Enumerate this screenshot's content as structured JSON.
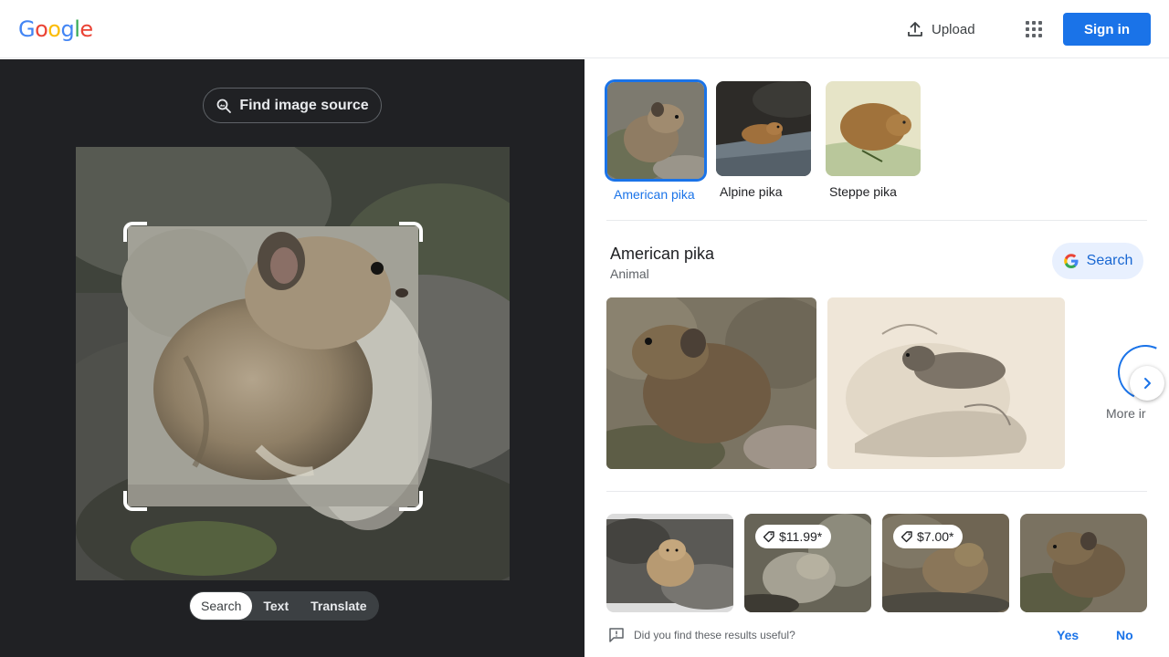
{
  "header": {
    "logo_letters": [
      {
        "ch": "G",
        "color": "#4285F4"
      },
      {
        "ch": "o",
        "color": "#EA4335"
      },
      {
        "ch": "o",
        "color": "#FBBC05"
      },
      {
        "ch": "g",
        "color": "#4285F4"
      },
      {
        "ch": "l",
        "color": "#34A853"
      },
      {
        "ch": "e",
        "color": "#EA4335"
      }
    ],
    "upload_label": "Upload",
    "apps_icon": "apps-grid-icon",
    "signin_label": "Sign in"
  },
  "left_panel": {
    "find_source_label": "Find image source",
    "modes": [
      {
        "label": "Search",
        "active": true
      },
      {
        "label": "Text",
        "active": false
      },
      {
        "label": "Translate",
        "active": false
      }
    ]
  },
  "right_panel": {
    "related": [
      {
        "label": "American pika",
        "selected": true
      },
      {
        "label": "Alpine pika",
        "selected": false
      },
      {
        "label": "Steppe pika",
        "selected": false
      }
    ],
    "entity": {
      "title": "American pika",
      "subtitle": "Animal",
      "search_label": "Search"
    },
    "more_label": "More ir",
    "results": [
      {
        "price": ""
      },
      {
        "price": "$11.99*"
      },
      {
        "price": "$7.00*"
      },
      {
        "price": ""
      }
    ],
    "feedback": {
      "question": "Did you find these results useful?",
      "yes": "Yes",
      "no": "No"
    }
  },
  "colors": {
    "accent": "#1a73e8",
    "dark_panel": "#202124"
  }
}
